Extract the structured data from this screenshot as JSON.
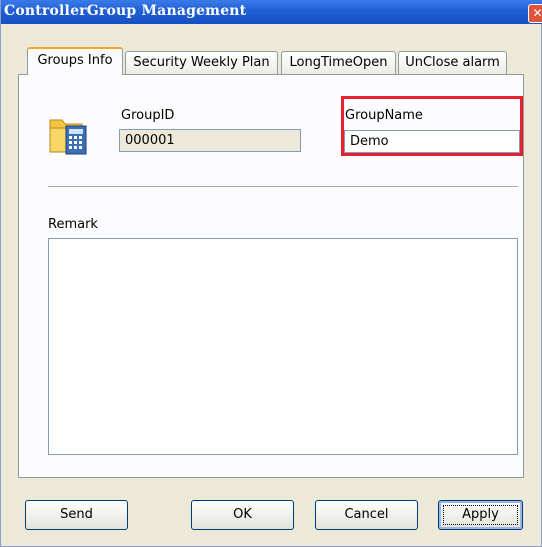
{
  "window": {
    "title": "ControllerGroup Management",
    "close_glyph": "✕"
  },
  "tabs": [
    {
      "label": "Groups Info",
      "active": true
    },
    {
      "label": "Security Weekly Plan",
      "active": false
    },
    {
      "label": "LongTimeOpen",
      "active": false
    },
    {
      "label": "UnClose alarm",
      "active": false
    }
  ],
  "form": {
    "group_id_label": "GroupID",
    "group_id_value": "000001",
    "group_name_label": "GroupName",
    "group_name_value": "Demo",
    "remark_label": "Remark",
    "remark_value": ""
  },
  "buttons": {
    "send": "Send",
    "ok": "OK",
    "cancel": "Cancel",
    "apply": "Apply"
  },
  "icon": {
    "name": "folder-calculator-icon"
  },
  "colors": {
    "title_bar": "#1f5fd4",
    "highlight_box": "#e8202a",
    "window_bg": "#ece9d8"
  }
}
